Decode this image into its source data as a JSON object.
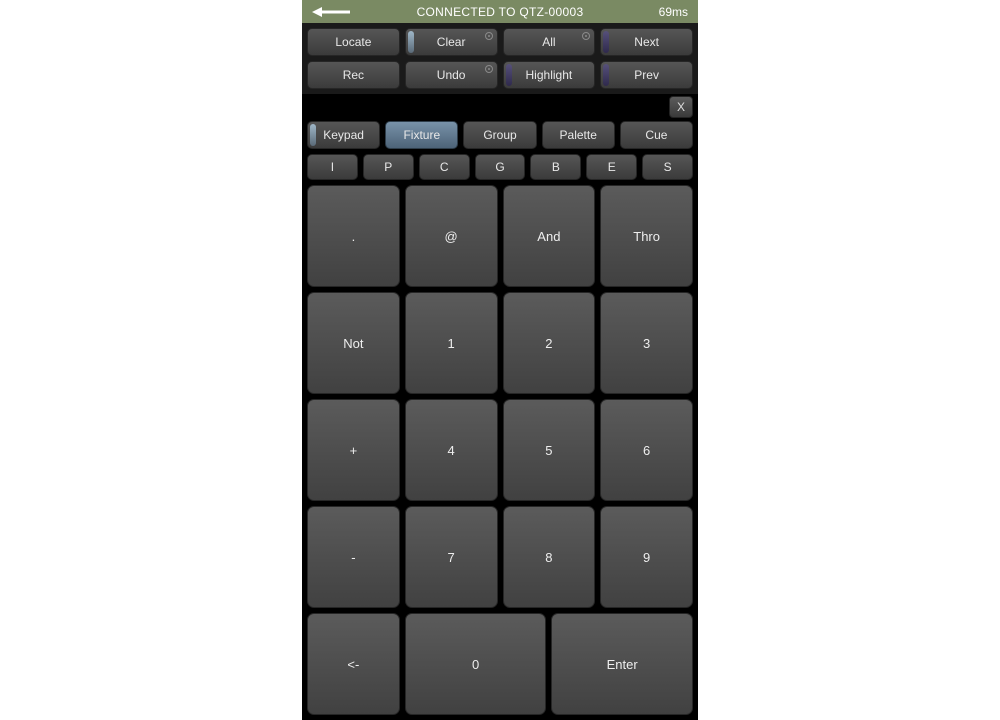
{
  "status": {
    "title": "CONNECTED TO QTZ-00003",
    "latency": "69ms"
  },
  "toolbar": {
    "row1": {
      "locate": "Locate",
      "clear": "Clear",
      "all": "All",
      "next": "Next"
    },
    "row2": {
      "rec": "Rec",
      "undo": "Undo",
      "highlight": "Highlight",
      "prev": "Prev"
    }
  },
  "close_x": "X",
  "tabs": {
    "keypad": "Keypad",
    "fixture": "Fixture",
    "group": "Group",
    "palette": "Palette",
    "cue": "Cue",
    "active": "fixture"
  },
  "attr_buttons": [
    "I",
    "P",
    "C",
    "G",
    "B",
    "E",
    "S"
  ],
  "keypad": {
    "r1": [
      ".",
      "@",
      "And",
      "Thro"
    ],
    "r2": [
      "Not",
      "1",
      "2",
      "3"
    ],
    "r3": [
      "+",
      "4",
      "5",
      "6"
    ],
    "r4": [
      "-",
      "7",
      "8",
      "9"
    ],
    "r5": [
      "<-",
      "0",
      "Enter"
    ]
  }
}
